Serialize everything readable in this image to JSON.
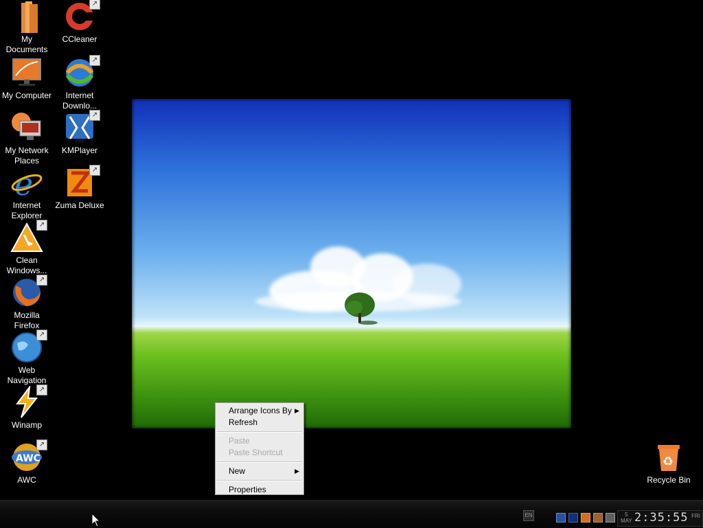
{
  "desktop": {
    "icons_col1": [
      {
        "label_1": "My",
        "label_2": "Documents",
        "icon": "folder-icon",
        "shortcut": false
      },
      {
        "label_1": "My Computer",
        "label_2": "",
        "icon": "computer-icon",
        "shortcut": false
      },
      {
        "label_1": "My Network",
        "label_2": "Places",
        "icon": "network-icon",
        "shortcut": false
      },
      {
        "label_1": "Internet",
        "label_2": "Explorer",
        "icon": "ie-icon",
        "shortcut": false
      },
      {
        "label_1": "Clean",
        "label_2": "Windows...",
        "icon": "clean-windows-icon",
        "shortcut": true
      },
      {
        "label_1": "Mozilla",
        "label_2": "Firefox",
        "icon": "firefox-icon",
        "shortcut": true
      },
      {
        "label_1": "Web",
        "label_2": "Navigation",
        "icon": "globe-icon",
        "shortcut": true
      },
      {
        "label_1": "Winamp",
        "label_2": "",
        "icon": "winamp-icon",
        "shortcut": true
      },
      {
        "label_1": "AWC",
        "label_2": "",
        "icon": "awc-icon",
        "shortcut": true
      }
    ],
    "icons_col2": [
      {
        "label_1": "CCleaner",
        "label_2": "",
        "icon": "ccleaner-icon",
        "shortcut": true
      },
      {
        "label_1": "Internet",
        "label_2": "Downlo...",
        "icon": "idm-icon",
        "shortcut": true
      },
      {
        "label_1": "KMPlayer",
        "label_2": "",
        "icon": "kmplayer-icon",
        "shortcut": true
      },
      {
        "label_1": "Zuma Deluxe",
        "label_2": "",
        "icon": "zuma-icon",
        "shortcut": true
      }
    ],
    "recycle_bin": {
      "label": "Recycle Bin",
      "icon": "recycle-bin-icon"
    }
  },
  "context_menu": {
    "items": [
      {
        "label": "Arrange Icons By",
        "submenu": true,
        "enabled": true
      },
      {
        "label": "Refresh",
        "submenu": false,
        "enabled": true
      },
      {
        "label": "Paste",
        "submenu": false,
        "enabled": false
      },
      {
        "label": "Paste Shortcut",
        "submenu": false,
        "enabled": false
      },
      {
        "label": "New",
        "submenu": true,
        "enabled": true
      },
      {
        "label": "Properties",
        "submenu": false,
        "enabled": true
      }
    ],
    "submenu_arrow": "▶"
  },
  "taskbar": {
    "language": "EN",
    "clock": {
      "day_num": "5",
      "month": "MAY",
      "time": "2:35:55",
      "weekday": "FRI"
    }
  },
  "colors": {
    "menu_bg": "#ebebeb",
    "desktop_bg": "#000000",
    "taskbar_bg": "#0c0c0c"
  }
}
